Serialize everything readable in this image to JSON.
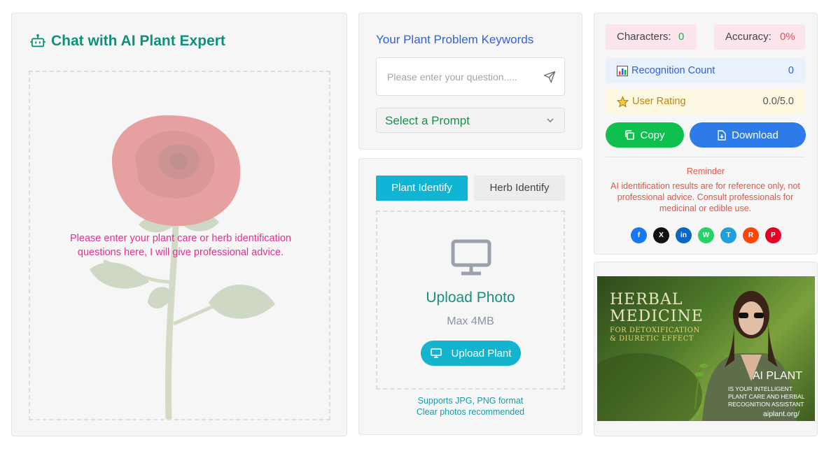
{
  "chat": {
    "title": "Chat with AI Plant Expert",
    "hint": "Please enter your plant care or herb identification questions here, I will give professional advice."
  },
  "keywords": {
    "title": "Your Plant Problem Keywords",
    "placeholder": "Please enter your question.....",
    "prompt_select": "Select a Prompt"
  },
  "identify": {
    "tabs": [
      "Plant Identify",
      "Herb Identify"
    ],
    "active_tab": "Plant Identify",
    "upload_title": "Upload Photo",
    "upload_max": "Max 4MB",
    "upload_button": "Upload Plant",
    "note_formats": "Supports JPG, PNG format",
    "note_clear": "Clear photos recommended"
  },
  "stats": {
    "characters_label": "Characters:",
    "characters_value": "0",
    "accuracy_label": "Accuracy:",
    "accuracy_value": "0%",
    "recognition_label": "Recognition Count",
    "recognition_value": "0",
    "rating_label": "User Rating",
    "rating_value": "0.0/5.0",
    "copy_button": "Copy",
    "download_button": "Download",
    "reminder_title": "Reminder",
    "reminder_text": "AI identification results are for reference only, not professional advice. Consult professionals for medicinal or edible use.",
    "social": [
      {
        "name": "facebook",
        "glyph": "f",
        "color": "#1877f2"
      },
      {
        "name": "x",
        "glyph": "X",
        "color": "#111111"
      },
      {
        "name": "linkedin",
        "glyph": "in",
        "color": "#0a66c2"
      },
      {
        "name": "whatsapp",
        "glyph": "W",
        "color": "#25d366"
      },
      {
        "name": "telegram",
        "glyph": "T",
        "color": "#1ea0dd"
      },
      {
        "name": "reddit",
        "glyph": "R",
        "color": "#ff4500"
      },
      {
        "name": "pinterest",
        "glyph": "P",
        "color": "#e60023"
      }
    ]
  },
  "ad": {
    "headline": "HERBAL MEDICINE",
    "headline_1": "HERBAL",
    "headline_2": "MEDICINE",
    "subheadline_1": "FOR DETOXIFICATION",
    "subheadline_2": "& DIURETIC EFFECT",
    "brand": "AI PLANT",
    "tagline_1": "IS YOUR INTELLIGENT",
    "tagline_2": "PLANT CARE AND HERBAL",
    "tagline_3": "RECOGNITION ASSISTANT",
    "url": "aiplant.org/"
  },
  "colors": {
    "accent_teal": "#0f8f7c",
    "accent_blue": "#2e62d9",
    "copy_green": "#0fc04f",
    "download_blue": "#2d7be8",
    "tab_active": "#10b5d6"
  }
}
